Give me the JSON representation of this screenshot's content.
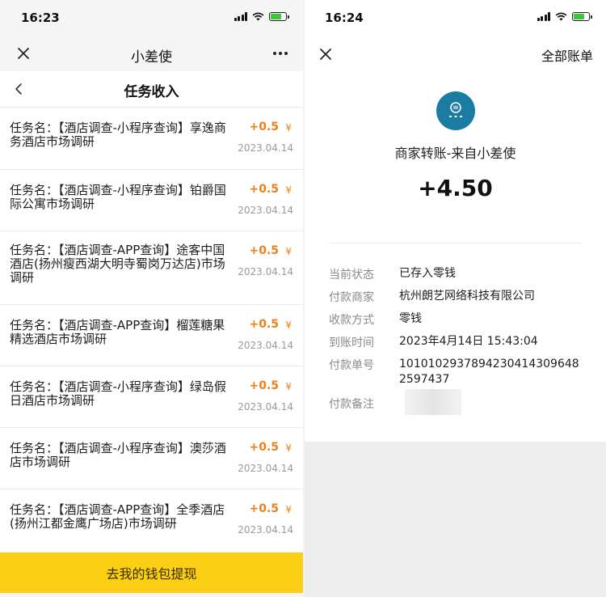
{
  "left": {
    "status": {
      "time": "16:23"
    },
    "nav": {
      "title": "小差使"
    },
    "subheader": {
      "title": "任务收入"
    },
    "tasks": [
      {
        "name": "任务名：【酒店调查-小程序查询】享逸商务酒店市场调研",
        "amount": "+0.5",
        "unit": "¥",
        "date": "2023.04.14"
      },
      {
        "name": "任务名：【酒店调查-小程序查询】铂爵国际公寓市场调研",
        "amount": "+0.5",
        "unit": "¥",
        "date": "2023.04.14"
      },
      {
        "name": "任务名：【酒店调查-APP查询】途客中国酒店(扬州瘦西湖大明寺蜀岗万达店)市场调研",
        "amount": "+0.5",
        "unit": "¥",
        "date": "2023.04.14"
      },
      {
        "name": "任务名：【酒店调查-APP查询】榴莲糖果精选酒店市场调研",
        "amount": "+0.5",
        "unit": "¥",
        "date": "2023.04.14"
      },
      {
        "name": "任务名：【酒店调查-小程序查询】绿岛假日酒店市场调研",
        "amount": "+0.5",
        "unit": "¥",
        "date": "2023.04.14"
      },
      {
        "name": "任务名：【酒店调查-小程序查询】澳莎酒店市场调研",
        "amount": "+0.5",
        "unit": "¥",
        "date": "2023.04.14"
      },
      {
        "name": "任务名：【酒店调查-APP查询】全季酒店(扬州江都金鹰广场店)市场调研",
        "amount": "+0.5",
        "unit": "¥",
        "date": "2023.04.14"
      }
    ],
    "withdraw_label": "去我的钱包提现"
  },
  "right": {
    "status": {
      "time": "16:24"
    },
    "nav": {
      "all_bills": "全部账单"
    },
    "merchant_title": "商家转账-来自小差使",
    "amount": "+4.50",
    "details": [
      {
        "label": "当前状态",
        "value": "已存入零钱"
      },
      {
        "label": "付款商家",
        "value": "杭州朗艺网络科技有限公司"
      },
      {
        "label": "收款方式",
        "value": "零钱"
      },
      {
        "label": "到账时间",
        "value": "2023年4月14日 15:43:04"
      },
      {
        "label": "付款单号",
        "value": "10101029378942304143096482597437"
      },
      {
        "label": "付款备注",
        "value": ""
      }
    ]
  },
  "colors": {
    "amount_orange": "#f07f1a",
    "withdraw_yellow": "#fbcf14",
    "logo_blue": "#1b7ba1",
    "battery_green": "#3ec43e"
  },
  "icons": [
    "close-icon",
    "more-icon",
    "back-chevron-icon",
    "signal-icon",
    "wifi-icon",
    "battery-icon",
    "merchant-logo"
  ]
}
